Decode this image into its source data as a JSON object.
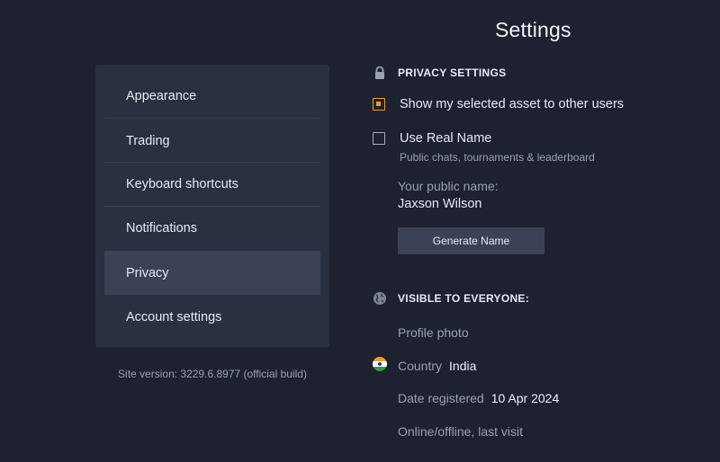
{
  "page": {
    "title": "Settings"
  },
  "menu": {
    "items": [
      {
        "label": "Appearance",
        "active": false
      },
      {
        "label": "Trading",
        "active": false
      },
      {
        "label": "Keyboard shortcuts",
        "active": false
      },
      {
        "label": "Notifications",
        "active": false
      },
      {
        "label": "Privacy",
        "active": true
      },
      {
        "label": "Account settings",
        "active": false
      }
    ]
  },
  "footer": {
    "site_version": "Site version: 3229.6.8977 (official build)"
  },
  "privacy": {
    "header": "PRIVACY SETTINGS",
    "header_icon": "lock-icon",
    "show_asset": {
      "label": "Show my selected asset to other users",
      "checked": true
    },
    "real_name": {
      "label": "Use Real Name",
      "checked": false,
      "note": "Public chats, tournaments & leaderboard"
    },
    "public_name_label": "Your public name:",
    "public_name_value": "Jaxson Wilson",
    "generate_button": "Generate Name"
  },
  "visible": {
    "header": "VISIBLE TO EVERYONE:",
    "header_icon": "globe-icon",
    "profile_photo": "Profile photo",
    "country_label": "Country",
    "country_value": "India",
    "country_flag": "india-flag-icon",
    "date_label": "Date registered",
    "date_value": "10 Apr 2024",
    "online_label": "Online/offline, last visit"
  },
  "colors": {
    "background": "#1d2130",
    "panel": "#2a3040",
    "active_item": "#3b4254",
    "accent": "#f59a23"
  }
}
